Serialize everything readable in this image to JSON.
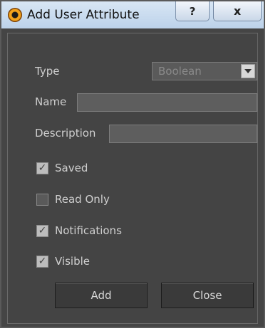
{
  "window": {
    "title": "Add User Attribute",
    "help_label": "?",
    "close_label": "x"
  },
  "form": {
    "type_label": "Type",
    "type_value": "Boolean",
    "name_label": "Name",
    "name_value": "",
    "description_label": "Description",
    "description_value": ""
  },
  "options": [
    {
      "label": "Saved",
      "checked": true
    },
    {
      "label": "Read Only",
      "checked": false
    },
    {
      "label": "Notifications",
      "checked": true
    },
    {
      "label": "Visible",
      "checked": true
    }
  ],
  "buttons": {
    "add_label": "Add",
    "close_label": "Close"
  }
}
